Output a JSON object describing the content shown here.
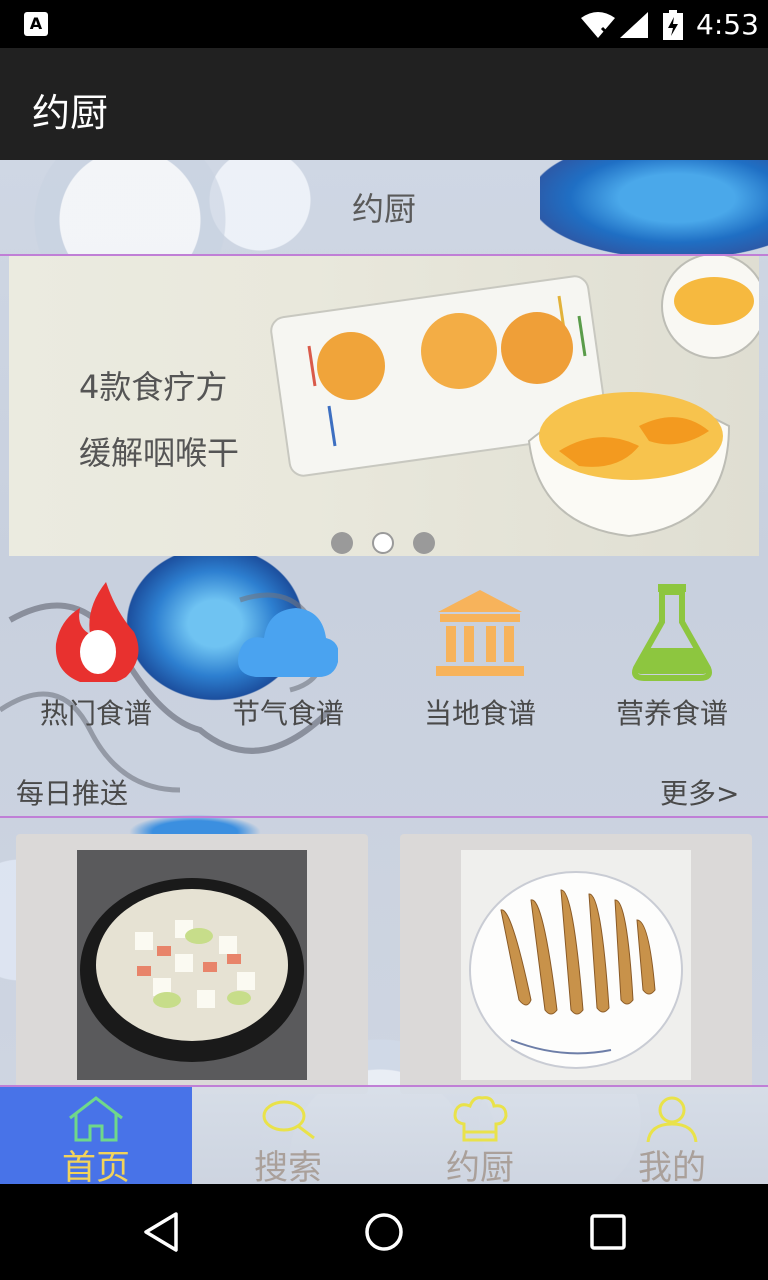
{
  "status_bar": {
    "app_icon_letter": "A",
    "time": "4:53"
  },
  "app_bar": {
    "title": "约厨"
  },
  "page": {
    "title": "约厨"
  },
  "banner": {
    "line1": "4款食疗方",
    "line2": "缓解咽喉干",
    "page_indicator": {
      "count": 3,
      "active_index": 1
    }
  },
  "categories": [
    {
      "label": "热门食谱",
      "icon": "flame-icon",
      "color": "#e8312f"
    },
    {
      "label": "节气食谱",
      "icon": "cloud-icon",
      "color": "#4aa3f0"
    },
    {
      "label": "当地食谱",
      "icon": "museum-icon",
      "color": "#f7b35b"
    },
    {
      "label": "营养食谱",
      "icon": "flask-icon",
      "color": "#8dc63f"
    }
  ],
  "daily": {
    "label": "每日推送",
    "more": "更多>"
  },
  "cards": [
    {
      "image": "tofu-cabbage-soup-photo"
    },
    {
      "image": "fried-small-fish-photo"
    }
  ],
  "bottom_nav": [
    {
      "label": "首页",
      "icon": "home-icon",
      "active": true
    },
    {
      "label": "搜索",
      "icon": "search-icon",
      "active": false
    },
    {
      "label": "约厨",
      "icon": "chef-hat-icon",
      "active": false
    },
    {
      "label": "我的",
      "icon": "user-icon",
      "active": false
    }
  ],
  "colors": {
    "accent_blue": "#4873e8",
    "divider_purple": "#c07fd6",
    "nav_active_text": "#f2d35a"
  }
}
